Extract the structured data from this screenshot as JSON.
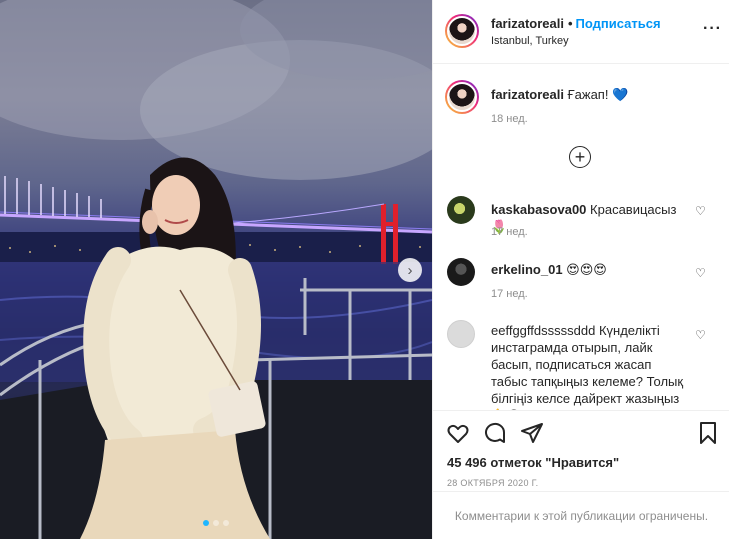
{
  "header": {
    "username": "farizatoreali",
    "follow_label": "Подписаться",
    "location": "Istanbul, Turkey"
  },
  "caption": {
    "username": "farizatoreali",
    "text": "Ғажап!",
    "heart": "💙",
    "time": "18 нед."
  },
  "comments": [
    {
      "username": "kaskabasova00",
      "text": "Красавицасыз🌷",
      "time": "17 нед."
    },
    {
      "username": "erkelino_01",
      "text": "😍😍😍",
      "time": "17 нед."
    },
    {
      "username": "eeffggffdsssssddd",
      "text": "Күнделікті инстаграмда отырып, лайк басып, подписаться жасап табыс тапқыңыз келеме? Толық білгіңіз келсе дайрект жазыңыз 👆😉"
    }
  ],
  "likes": "45 496 отметок \"Нравится\"",
  "date": "28 ОКТЯБРЯ 2020 Г.",
  "comments_closed": "Комментарии к этой публикации ограничены.",
  "carousel": {
    "total": 3,
    "current": 1
  },
  "colors": {
    "accent": "#0095f6",
    "muted": "#8e8e8e",
    "heart": "#1fb6ff"
  },
  "icons": [
    "plus-circle-icon",
    "heart-icon",
    "comment-icon",
    "share-icon",
    "bookmark-icon",
    "more-icon",
    "chevron-right-icon"
  ]
}
